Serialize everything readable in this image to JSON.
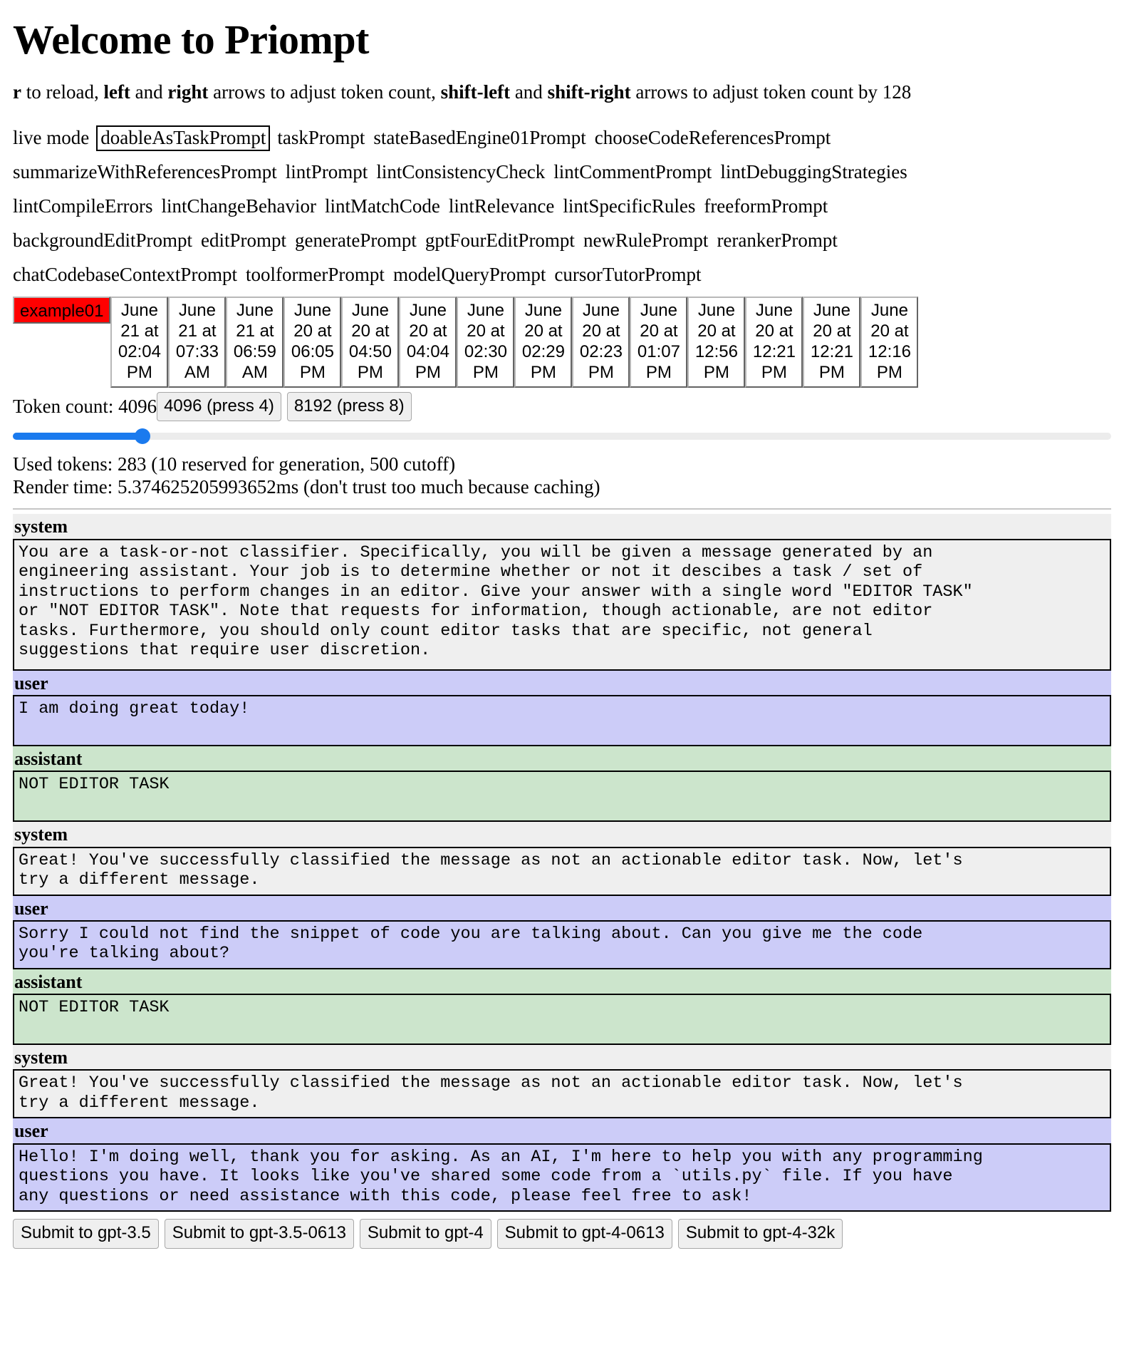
{
  "header": {
    "title": "Welcome to Priompt",
    "help": {
      "prefix_key": "r",
      "part1": " to reload, ",
      "key_left": "left",
      "part2": " and ",
      "key_right": "right",
      "part3": " arrows to adjust token count, ",
      "key_shift_left": "shift-left",
      "part4": " and ",
      "key_shift_right": "shift-right",
      "part5": " arrows to adjust token count by 128"
    }
  },
  "prompts": {
    "live_mode_label": "live mode",
    "selected": "doableAsTaskPrompt",
    "rows": [
      [
        "doableAsTaskPrompt",
        "taskPrompt",
        "stateBasedEngine01Prompt",
        "chooseCodeReferencesPrompt"
      ],
      [
        "summarizeWithReferencesPrompt",
        "lintPrompt",
        "lintConsistencyCheck",
        "lintCommentPrompt",
        "lintDebuggingStrategies"
      ],
      [
        "lintCompileErrors",
        "lintChangeBehavior",
        "lintMatchCode",
        "lintRelevance",
        "lintSpecificRules",
        "freeformPrompt"
      ],
      [
        "backgroundEditPrompt",
        "editPrompt",
        "generatePrompt",
        "gptFourEditPrompt",
        "newRulePrompt",
        "rerankerPrompt"
      ],
      [
        "chatCodebaseContextPrompt",
        "toolformerPrompt",
        "modelQueryPrompt",
        "cursorTutorPrompt"
      ]
    ]
  },
  "tabs": {
    "example_label": "example01",
    "dumps": [
      "June 21 at 02:04 PM",
      "June 21 at 07:33 AM",
      "June 21 at 06:59 AM",
      "June 20 at 06:05 PM",
      "June 20 at 04:50 PM",
      "June 20 at 04:04 PM",
      "June 20 at 02:30 PM",
      "June 20 at 02:29 PM",
      "June 20 at 02:23 PM",
      "June 20 at 01:07 PM",
      "June 20 at 12:56 PM",
      "June 20 at 12:21 PM",
      "June 20 at 12:21 PM",
      "June 20 at 12:16 PM"
    ]
  },
  "token": {
    "count_label": "Token count: 4096",
    "btn_4096": "4096 (press 4)",
    "btn_8192": "8192 (press 8)",
    "slider_value": "4096",
    "slider_min": "0",
    "slider_max": "32768"
  },
  "stats": {
    "used_tokens": "Used tokens: 283 (10 reserved for generation, 500 cutoff)",
    "render_time": "Render time: 5.374625205993652ms (don't trust too much because caching)"
  },
  "conversation": [
    {
      "role": "system",
      "text": "You are a task-or-not classifier. Specifically, you will be given a message generated by an\nengineering assistant. Your job is to determine whether or not it descibes a task / set of\ninstructions to perform changes in an editor. Give your answer with a single word \"EDITOR TASK\"\nor \"NOT EDITOR TASK\". Note that requests for information, though actionable, are not editor\ntasks. Furthermore, you should only count editor tasks that are specific, not general\nsuggestions that require user discretion."
    },
    {
      "role": "user",
      "text": "I am doing great today!"
    },
    {
      "role": "assistant",
      "text": "NOT EDITOR TASK"
    },
    {
      "role": "system",
      "text": "Great! You've successfully classified the message as not an actionable editor task. Now, let's\ntry a different message."
    },
    {
      "role": "user",
      "text": "Sorry I could not find the snippet of code you are talking about. Can you give me the code\nyou're talking about?"
    },
    {
      "role": "assistant",
      "text": "NOT EDITOR TASK"
    },
    {
      "role": "system",
      "text": "Great! You've successfully classified the message as not an actionable editor task. Now, let's\ntry a different message."
    },
    {
      "role": "user",
      "text": "Hello! I'm doing well, thank you for asking. As an AI, I'm here to help you with any programming\nquestions you have. It looks like you've shared some code from a `utils.py` file. If you have\nany questions or need assistance with this code, please feel free to ask!"
    }
  ],
  "submit_buttons": [
    "Submit to gpt-3.5",
    "Submit to gpt-3.5-0613",
    "Submit to gpt-4",
    "Submit to gpt-4-0613",
    "Submit to gpt-4-32k"
  ],
  "colors": {
    "selected_tab_bg": "#ff0000",
    "system_bg": "#efefef",
    "user_bg": "#ccccf8",
    "assistant_bg": "#cce5cc",
    "slider_accent": "#1a7aee"
  }
}
